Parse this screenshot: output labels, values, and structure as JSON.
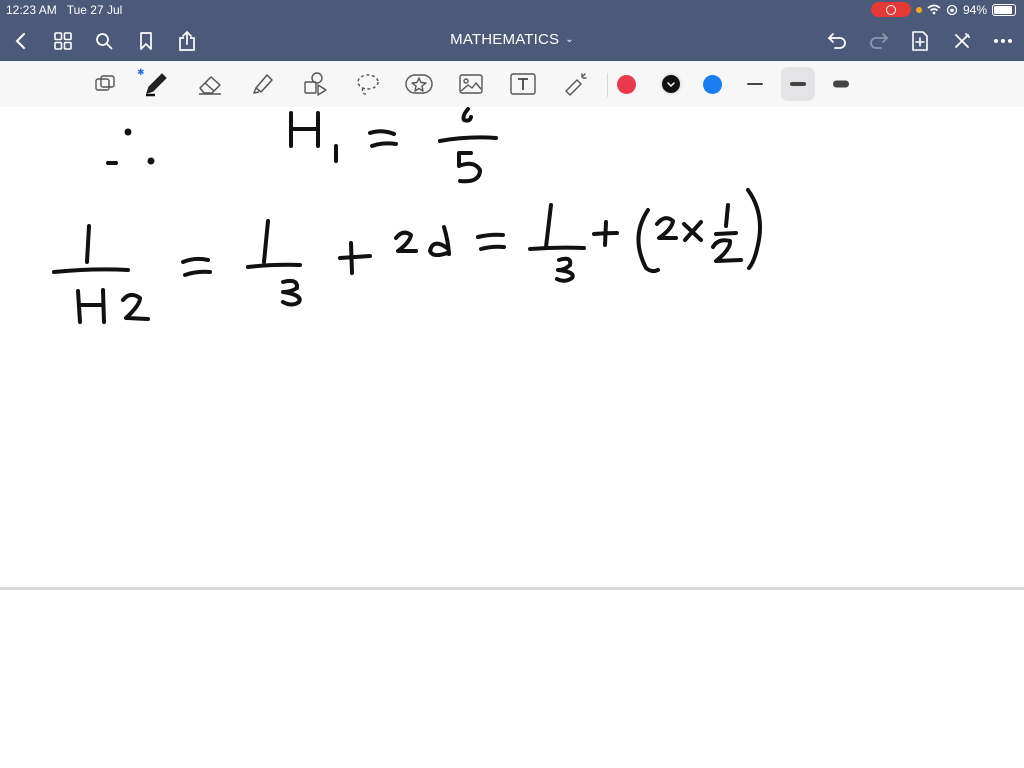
{
  "status_bar": {
    "time": "12:23 AM",
    "date": "Tue 27 Jul",
    "battery": "94%",
    "battery_level": 0.94
  },
  "nav": {
    "title": "MATHEMATICS",
    "icons": [
      "back-icon",
      "grid-icon",
      "search-icon",
      "bookmark-icon",
      "share-icon",
      "undo-icon",
      "redo-icon",
      "add-page-icon",
      "close-icon",
      "more-icon"
    ]
  },
  "toolbar": {
    "tools": [
      "lasso-scan-icon",
      "pen-icon",
      "eraser-icon",
      "highlighter-icon",
      "shapes-icon",
      "lasso-icon",
      "sticker-icon",
      "image-icon",
      "text-icon",
      "laser-pointer-icon"
    ],
    "colors": [
      "#e8394f",
      "#111111",
      "#1a7ef2"
    ],
    "selected_color": "#111111",
    "stroke_widths": [
      "thin",
      "medium",
      "thick"
    ],
    "selected_stroke": "medium"
  }
}
